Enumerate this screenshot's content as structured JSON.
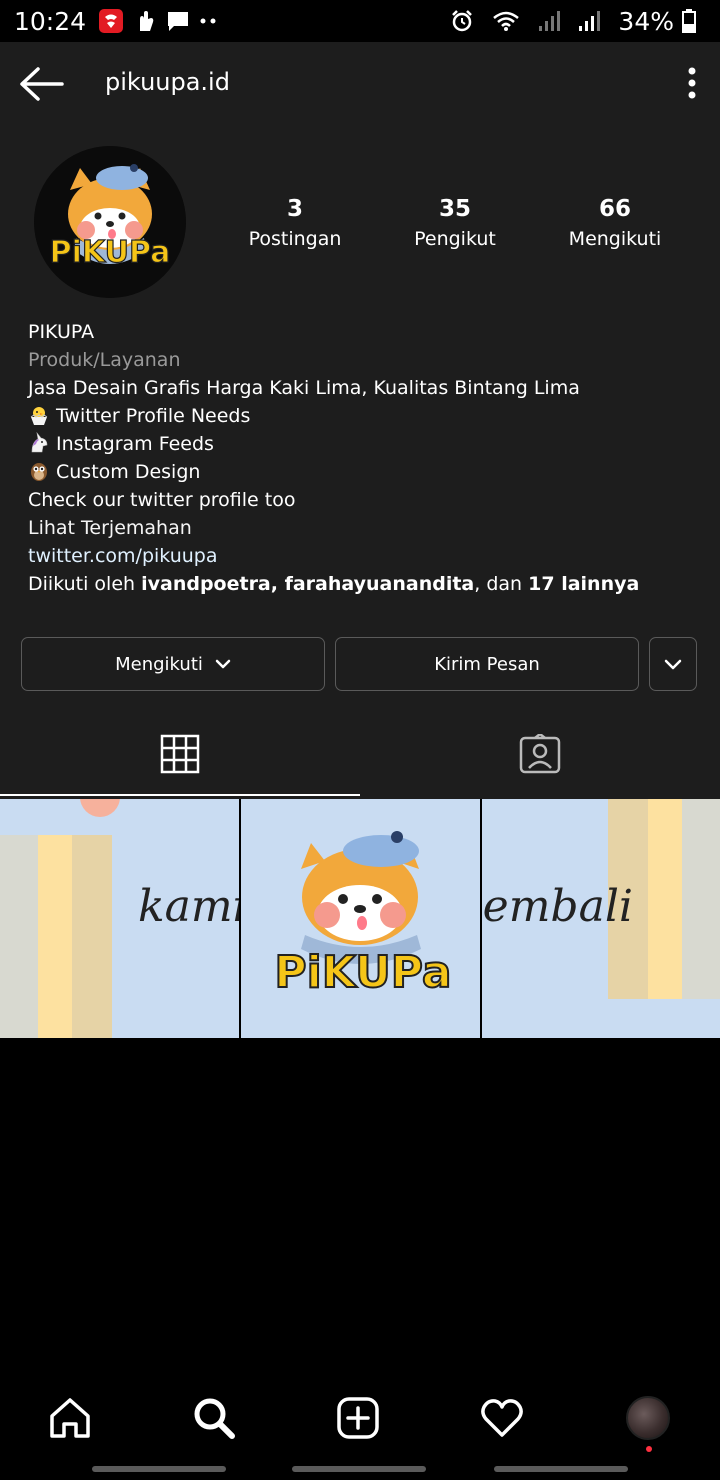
{
  "status_bar": {
    "time": "10:24",
    "battery": "34%",
    "left_icons": [
      "telkomsel-app-icon",
      "hand-icon",
      "message-icon",
      "more-dots-icon"
    ],
    "right_icons": [
      "alarm-icon",
      "wifi-icon",
      "signal-icon",
      "signal-icon",
      "battery-icon"
    ]
  },
  "header": {
    "handle": "pikuupa.id"
  },
  "profile": {
    "avatar_text": "PiKUPa",
    "stats": [
      {
        "value": "3",
        "label": "Postingan"
      },
      {
        "value": "35",
        "label": "Pengikut"
      },
      {
        "value": "66",
        "label": "Mengikuti"
      }
    ],
    "name": "PIKUPA",
    "category": "Produk/Layanan",
    "bio_lines": [
      "Jasa Desain Grafis Harga Kaki Lima, Kualitas Bintang Lima",
      "Twitter Profile Needs",
      "Instagram Feeds",
      "Custom Design",
      "Check our twitter profile too"
    ],
    "translate": "Lihat Terjemahan",
    "link": "twitter.com/pikuupa",
    "followed_by": {
      "prefix": "Diikuti oleh ",
      "users": "ivandpoetra, farahayuanandita",
      "middle": ", dan ",
      "others": "17 lainnya"
    }
  },
  "actions": {
    "follow_label": "Mengikuti",
    "message_label": "Kirim Pesan"
  },
  "posts": [
    {
      "caption": "kami"
    },
    {
      "caption": "PiKUPa"
    },
    {
      "caption": "kembali"
    }
  ],
  "colors": {
    "background": "#1d1d1d",
    "link": "#e0f1ff",
    "post_bg": "#c9dcf2",
    "brand_yellow": "#f5b82e",
    "notification_dot": "#ff3040"
  }
}
